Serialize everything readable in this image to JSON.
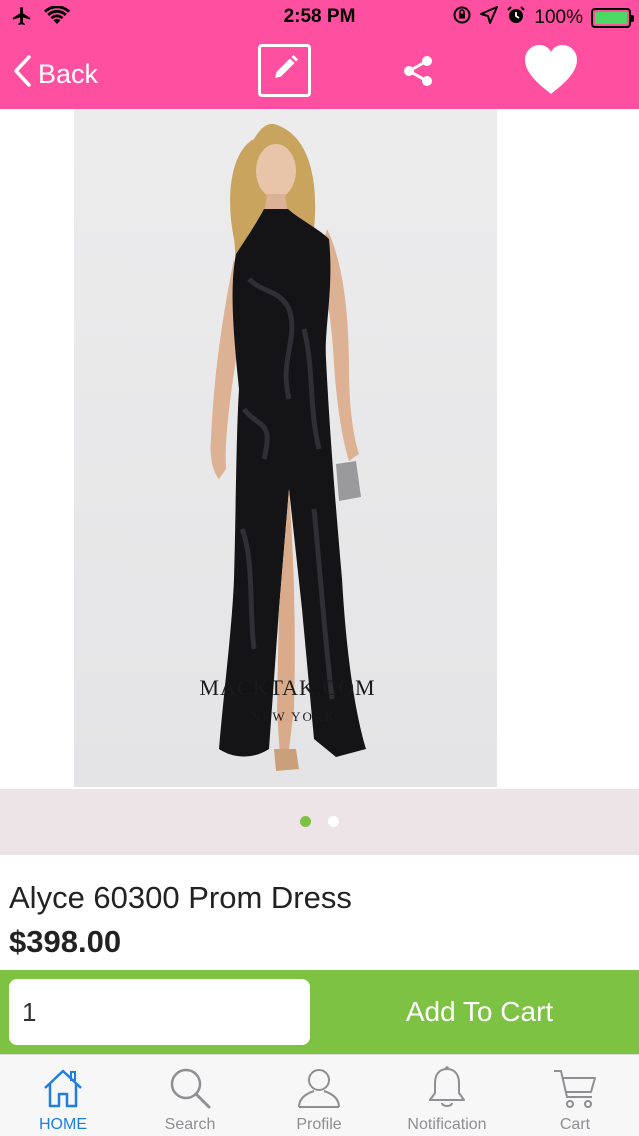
{
  "status_bar": {
    "time": "2:58 PM",
    "battery_percent": "100%",
    "battery_level": 1.0,
    "battery_color": "#4cd964",
    "icons": [
      "airplane-icon",
      "wifi-icon",
      "rotation-lock-icon",
      "location-icon",
      "alarm-icon",
      "battery-icon"
    ]
  },
  "nav": {
    "back_label": "Back",
    "icons": [
      "chevron-left-icon",
      "edit-icon",
      "share-icon",
      "heart-icon"
    ],
    "background_color": "#ff4fa0"
  },
  "gallery": {
    "watermark_main": "MACKTAK.COM",
    "watermark_sub": "NEW YORK",
    "page_count": 2,
    "current_page": 1,
    "active_dot_color": "#7dc242"
  },
  "product": {
    "title": "Alyce 60300 Prom Dress",
    "price": "$398.00"
  },
  "cart": {
    "quantity": "1",
    "add_label": "Add To Cart",
    "accent_color": "#7dc242"
  },
  "tabs": [
    {
      "label": "HOME",
      "icon": "home-icon",
      "active": true
    },
    {
      "label": "Search",
      "icon": "search-icon",
      "active": false
    },
    {
      "label": "Profile",
      "icon": "profile-icon",
      "active": false
    },
    {
      "label": "Notification",
      "icon": "bell-icon",
      "active": false
    },
    {
      "label": "Cart",
      "icon": "cart-icon",
      "active": false
    }
  ]
}
